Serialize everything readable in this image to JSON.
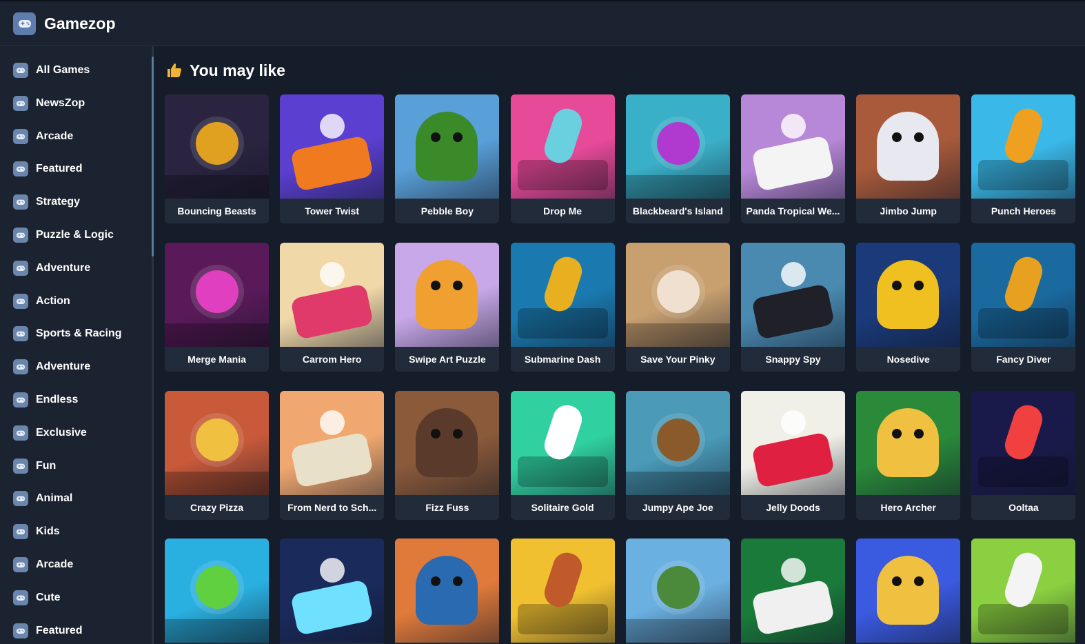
{
  "app": {
    "title": "Gamezop",
    "logo_icon": "gamepad-logo-icon"
  },
  "sidebar": {
    "items": [
      {
        "label": "All Games",
        "icon": "category-icon"
      },
      {
        "label": "NewsZop",
        "icon": "category-icon"
      },
      {
        "label": "Arcade",
        "icon": "category-icon"
      },
      {
        "label": "Featured",
        "icon": "category-icon"
      },
      {
        "label": "Strategy",
        "icon": "category-icon"
      },
      {
        "label": "Puzzle & Logic",
        "icon": "category-icon"
      },
      {
        "label": "Adventure",
        "icon": "category-icon"
      },
      {
        "label": "Action",
        "icon": "category-icon"
      },
      {
        "label": "Sports & Racing",
        "icon": "category-icon"
      },
      {
        "label": "Adventure",
        "icon": "category-icon"
      },
      {
        "label": "Endless",
        "icon": "category-icon"
      },
      {
        "label": "Exclusive",
        "icon": "category-icon"
      },
      {
        "label": "Fun",
        "icon": "category-icon"
      },
      {
        "label": "Animal",
        "icon": "category-icon"
      },
      {
        "label": "Kids",
        "icon": "category-icon"
      },
      {
        "label": "Arcade",
        "icon": "category-icon"
      },
      {
        "label": "Cute",
        "icon": "category-icon"
      },
      {
        "label": "Featured",
        "icon": "category-icon"
      }
    ]
  },
  "main": {
    "section_title": "You may like",
    "section_icon": "thumbs-up-icon",
    "games": [
      {
        "title": "Bouncing Beasts",
        "art": {
          "bg": "#2a2440",
          "accent": "#e0a020"
        }
      },
      {
        "title": "Tower Twist",
        "art": {
          "bg": "#5a3fd0",
          "accent": "#f07a20"
        }
      },
      {
        "title": "Pebble Boy",
        "art": {
          "bg": "#5aa0d8",
          "accent": "#3a8a2a"
        }
      },
      {
        "title": "Drop Me",
        "art": {
          "bg": "#e84a9a",
          "accent": "#6ad0e0"
        }
      },
      {
        "title": "Blackbeard's Island",
        "art": {
          "bg": "#3ab0c8",
          "accent": "#b03ad0"
        }
      },
      {
        "title": "Panda Tropical We...",
        "art": {
          "bg": "#b888d8",
          "accent": "#f4f4f4"
        }
      },
      {
        "title": "Jimbo Jump",
        "art": {
          "bg": "#a85a3a",
          "accent": "#e8e8f0"
        }
      },
      {
        "title": "Punch Heroes",
        "art": {
          "bg": "#3ab8e8",
          "accent": "#f0a020"
        }
      },
      {
        "title": "Merge Mania",
        "art": {
          "bg": "#5a1a5a",
          "accent": "#e040c0"
        }
      },
      {
        "title": "Carrom Hero",
        "art": {
          "bg": "#f0d8a8",
          "accent": "#e03a6a"
        }
      },
      {
        "title": "Swipe Art Puzzle",
        "art": {
          "bg": "#c8a8e8",
          "accent": "#f0a030"
        }
      },
      {
        "title": "Submarine Dash",
        "art": {
          "bg": "#1a7ab0",
          "accent": "#e8b020"
        }
      },
      {
        "title": "Save Your Pinky",
        "art": {
          "bg": "#c8a070",
          "accent": "#f0e0d0"
        }
      },
      {
        "title": "Snappy Spy",
        "art": {
          "bg": "#4a8ab0",
          "accent": "#202028"
        }
      },
      {
        "title": "Nosedive",
        "art": {
          "bg": "#1a3a7a",
          "accent": "#f0c020"
        }
      },
      {
        "title": "Fancy Diver",
        "art": {
          "bg": "#1a6aa0",
          "accent": "#e8a020"
        }
      },
      {
        "title": "Crazy Pizza",
        "art": {
          "bg": "#c85a3a",
          "accent": "#f0c040"
        }
      },
      {
        "title": "From Nerd to Sch...",
        "art": {
          "bg": "#f0a870",
          "accent": "#e8e0c8"
        }
      },
      {
        "title": "Fizz Fuss",
        "art": {
          "bg": "#8a5a3a",
          "accent": "#5a3a2a"
        }
      },
      {
        "title": "Solitaire Gold",
        "art": {
          "bg": "#30d0a0",
          "accent": "#ffffff"
        }
      },
      {
        "title": "Jumpy Ape Joe",
        "art": {
          "bg": "#4a9ab8",
          "accent": "#8a5a2a"
        }
      },
      {
        "title": "Jelly Doods",
        "art": {
          "bg": "#f0f0e8",
          "accent": "#e02040"
        }
      },
      {
        "title": "Hero Archer",
        "art": {
          "bg": "#2a8a3a",
          "accent": "#f0c040"
        }
      },
      {
        "title": "Ooltaa",
        "art": {
          "bg": "#1a1a4a",
          "accent": "#f04040"
        }
      },
      {
        "title": "",
        "art": {
          "bg": "#2ab0e0",
          "accent": "#60d040"
        }
      },
      {
        "title": "",
        "art": {
          "bg": "#1a2a5a",
          "accent": "#70e0ff"
        }
      },
      {
        "title": "",
        "art": {
          "bg": "#e07a3a",
          "accent": "#2a6ab0"
        }
      },
      {
        "title": "",
        "art": {
          "bg": "#f0c030",
          "accent": "#c05a2a"
        }
      },
      {
        "title": "",
        "art": {
          "bg": "#6ab0e0",
          "accent": "#4a8a3a"
        }
      },
      {
        "title": "",
        "art": {
          "bg": "#1a7a3a",
          "accent": "#f0f0f0"
        }
      },
      {
        "title": "",
        "art": {
          "bg": "#3a5ae0",
          "accent": "#f0c040"
        }
      },
      {
        "title": "",
        "art": {
          "bg": "#8ad040",
          "accent": "#f4f4f4"
        }
      }
    ]
  }
}
